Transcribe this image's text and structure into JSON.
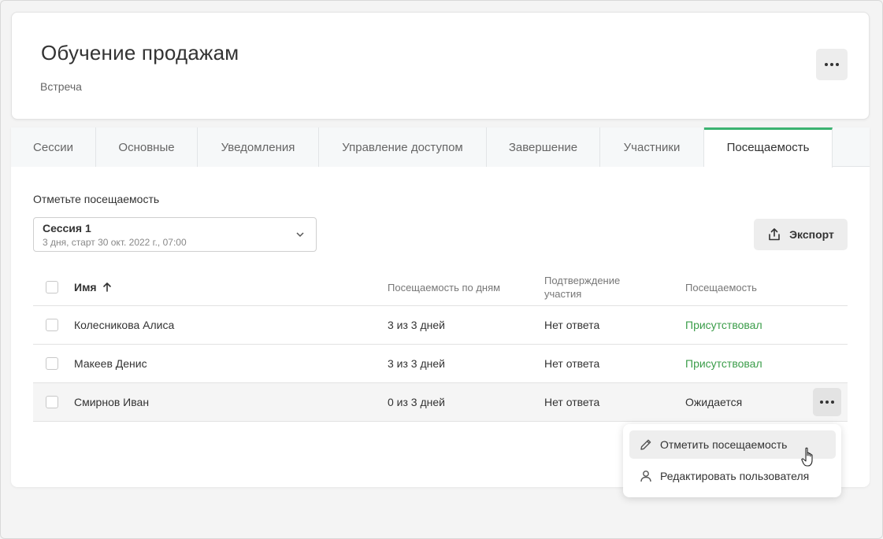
{
  "header": {
    "title": "Обучение продажам",
    "subtitle": "Встреча",
    "more_icon": "more-horizontal-icon"
  },
  "tabs": [
    {
      "label": "Сессии",
      "active": false
    },
    {
      "label": "Основные",
      "active": false
    },
    {
      "label": "Уведомления",
      "active": false
    },
    {
      "label": "Управление доступом",
      "active": false
    },
    {
      "label": "Завершение",
      "active": false
    },
    {
      "label": "Участники",
      "active": false
    },
    {
      "label": "Посещаемость",
      "active": true
    }
  ],
  "attendance": {
    "label": "Отметьте посещаемость",
    "session": {
      "name": "Сессия 1",
      "meta": "3 дня, старт 30 окт. 2022 г., 07:00"
    },
    "export_label": "Экспорт"
  },
  "table": {
    "columns": {
      "name": "Имя",
      "days": "Посещаемость по дням",
      "confirmation": "Подтверждение участия",
      "attendance": "Посещаемость"
    },
    "rows": [
      {
        "name": "Колесникова Алиса",
        "days": "3 из 3 дней",
        "confirmation": "Нет ответа",
        "attendance": "Присутствовал",
        "status": "present"
      },
      {
        "name": "Макеев Денис",
        "days": "3 из 3 дней",
        "confirmation": "Нет ответа",
        "attendance": "Присутствовал",
        "status": "present"
      },
      {
        "name": "Смирнов Иван",
        "days": "0 из 3 дней",
        "confirmation": "Нет ответа",
        "attendance": "Ожидается",
        "status": "pending"
      }
    ]
  },
  "context_menu": {
    "items": [
      {
        "label": "Отметить посещаемость",
        "icon": "pencil-icon"
      },
      {
        "label": "Редактировать пользователя",
        "icon": "user-icon"
      }
    ]
  },
  "colors": {
    "accent": "#3cb371",
    "present": "#3b9d4a"
  }
}
